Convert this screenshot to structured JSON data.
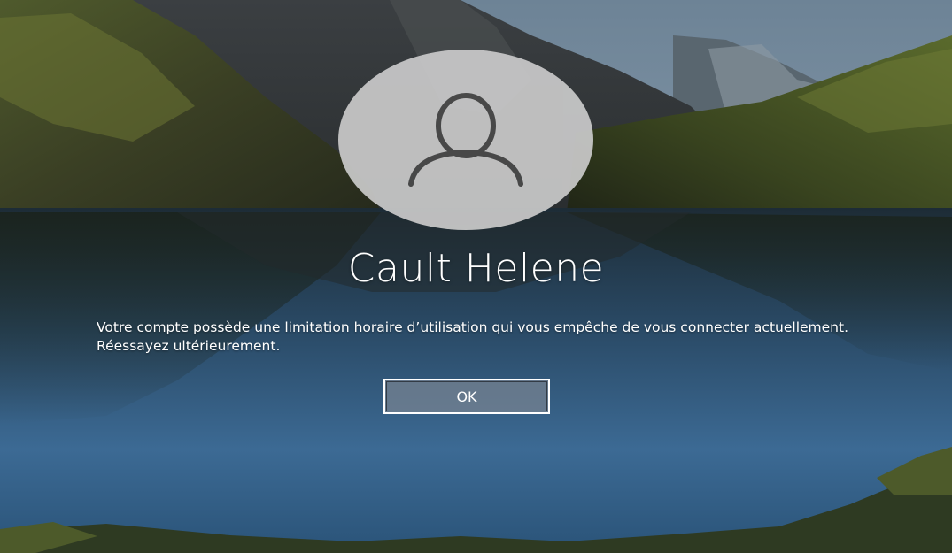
{
  "lock_screen": {
    "user_name": "Cault Helene",
    "message": "Votre compte possède une limitation horaire d’utilisation qui vous empêche de vous connecter actuellement. Réessayez ultérieurement.",
    "ok_label": "OK",
    "avatar_icon": "user-icon",
    "background_image": "mountain-lake-wallpaper"
  },
  "colors": {
    "avatar_bg": "#c9c9c9",
    "avatar_icon": "#4a4a4a",
    "text": "#ffffff",
    "button_bg": "#788492"
  }
}
